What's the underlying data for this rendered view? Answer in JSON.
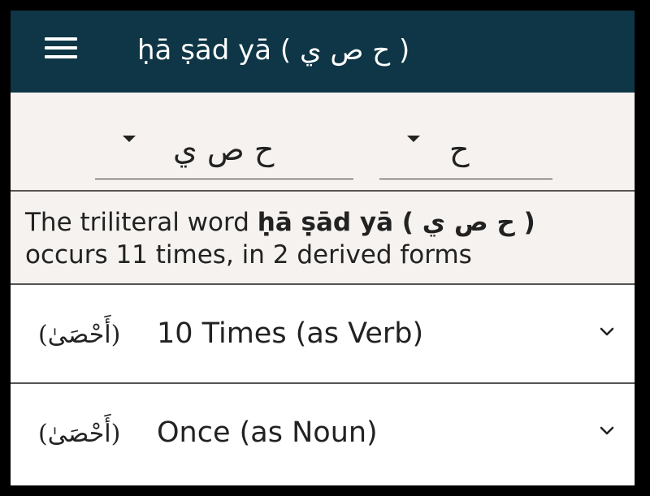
{
  "header": {
    "title": "ḥā ṣād yā ( ح ص ي )"
  },
  "selectors": {
    "root": "ح ص ي",
    "letter": "ح"
  },
  "summary": {
    "prefix": "The triliteral word ",
    "word": "ḥā ṣād yā ( ح ص ي )",
    "suffix": " occurs 11 times, in 2 derived forms"
  },
  "forms": [
    {
      "arabic": "(أَحْصَىٰ)",
      "label": "10 Times (as Verb)"
    },
    {
      "arabic": "(أَحْصَىٰ)",
      "label": "Once (as Noun)"
    }
  ],
  "colors": {
    "appbar": "#0e3646",
    "panel": "#f5f2ef",
    "text": "#222222"
  },
  "icons": {
    "menu": "hamburger-menu-icon",
    "dropdown": "caret-down-icon",
    "expand": "chevron-down-icon"
  }
}
